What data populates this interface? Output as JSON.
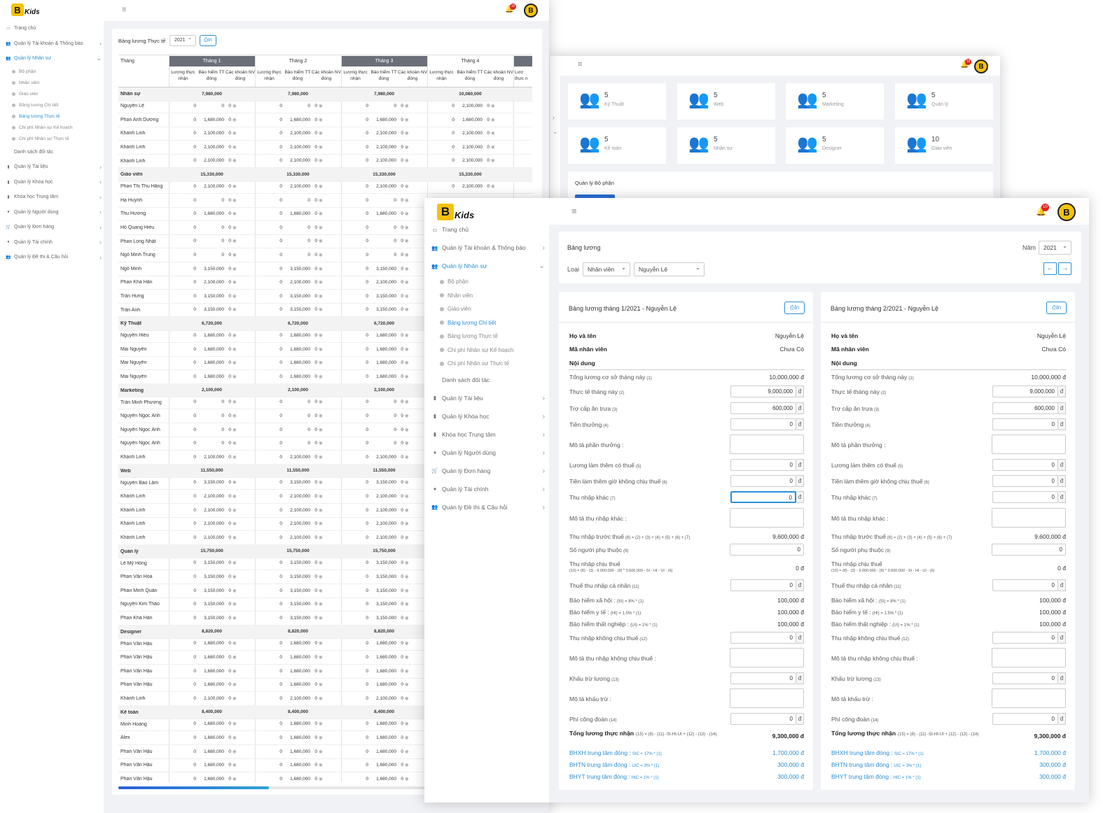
{
  "brand": {
    "logo_letter": "B",
    "logo_text": "Kids",
    "notif_count": "10"
  },
  "sidebar": {
    "items": [
      {
        "label": "Trang chủ",
        "icon": "monitor-icon"
      },
      {
        "label": "Quản lý Tài khoản & Thông báo",
        "icon": "users-icon"
      },
      {
        "label": "Quản lý Nhân sự",
        "icon": "users-icon",
        "active": true
      },
      {
        "label": "Danh sách đối tác",
        "icon": "none"
      },
      {
        "label": "Quản lý Tài liệu",
        "icon": "file-icon"
      },
      {
        "label": "Quản lý Khóa học",
        "icon": "book-icon"
      },
      {
        "label": "Khóa học Trung tâm",
        "icon": "book-icon"
      },
      {
        "label": "Quản lý Người dùng",
        "icon": "user-icon"
      },
      {
        "label": "Quản lý Đơn hàng",
        "icon": "cart-icon"
      },
      {
        "label": "Quản lý Tài chính",
        "icon": "user-icon"
      },
      {
        "label": "Quản lý Đề thi & Câu hỏi",
        "icon": "users-icon"
      }
    ],
    "sub": [
      "Bộ phận",
      "Nhân viên",
      "Giáo viên",
      "Bảng lương Chi tiết",
      "Bảng lương Thực tế",
      "Chi phí Nhân sự Kế hoạch",
      "Chi phí Nhân sự Thực tế"
    ]
  },
  "win1": {
    "title": "Bảng lương Thực tế",
    "year": "2021",
    "print": "In",
    "col_thang": "Tháng",
    "months": [
      "Tháng 1",
      "Tháng 2",
      "Tháng 3",
      "Tháng 4"
    ],
    "sub_cols": [
      "Lương thực nhận",
      "Bảo hiểm TT đóng",
      "Các khoản NV đóng"
    ],
    "sub_cut": "Lươ thực n",
    "rows": [
      {
        "g": 1,
        "n": "Nhân sự",
        "t": [
          "7,980,000",
          "7,980,000",
          "7,980,000",
          "10,080,000"
        ]
      },
      {
        "n": "Nguyễn Lệ",
        "b": [
          "0",
          "0",
          "0",
          "2,100,000"
        ]
      },
      {
        "n": "Phan Anh Dương",
        "b": [
          "1,680,000",
          "1,680,000",
          "1,680,000",
          "1,680,000"
        ]
      },
      {
        "n": "Khánh Linh",
        "b": [
          "2,100,000",
          "2,100,000",
          "2,100,000",
          "2,100,000"
        ]
      },
      {
        "n": "Khánh Linh",
        "b": [
          "2,100,000",
          "2,100,000",
          "2,100,000",
          "2,100,000"
        ]
      },
      {
        "n": "Khánh Linh",
        "b": [
          "2,100,000",
          "2,100,000",
          "2,100,000",
          "2,100,000"
        ]
      },
      {
        "g": 1,
        "n": "Giáo viên",
        "t": [
          "15,330,000",
          "15,330,000",
          "15,330,000",
          "15,330,000"
        ]
      },
      {
        "n": "Phan Thị Thu Hằng",
        "b": [
          "2,100,000",
          "2,100,000",
          "2,100,000",
          "2,100,000"
        ]
      },
      {
        "n": "Hạ Huynh",
        "b": [
          "0",
          "0",
          "0",
          "0"
        ]
      },
      {
        "n": "Thu Hương",
        "b": [
          "1,680,000",
          "1,680,000",
          "1,680,000",
          "1,680,000"
        ]
      },
      {
        "n": "Hồ Quang Hiếu",
        "b": [
          "0",
          "0",
          "0",
          "0"
        ]
      },
      {
        "n": "Phan Long Nhật",
        "b": [
          "0",
          "0",
          "0",
          "0"
        ]
      },
      {
        "n": "Ngô Minh Trung",
        "b": [
          "0",
          "0",
          "0",
          "0"
        ]
      },
      {
        "n": "Ngô Minh",
        "b": [
          "3,150,000",
          "3,150,000",
          "3,150,000",
          "3,150,000"
        ]
      },
      {
        "n": "Phan Khả Hân",
        "b": [
          "2,100,000",
          "2,100,000",
          "2,100,000",
          "2,100,000"
        ]
      },
      {
        "n": "Trần Hưng",
        "b": [
          "3,150,000",
          "3,150,000",
          "3,150,000",
          "3,150,000"
        ]
      },
      {
        "n": "Trần Anh",
        "b": [
          "3,150,000",
          "3,150,000",
          "3,150,000",
          "3,150,000"
        ]
      },
      {
        "g": 1,
        "n": "Kỹ Thuật",
        "t": [
          "6,720,000",
          "6,720,000",
          "6,720,000",
          "6,720,000"
        ]
      },
      {
        "n": "Nguyễn Hiếu",
        "b": [
          "1,680,000",
          "1,680,000",
          "1,680,000",
          "1,680,000"
        ]
      },
      {
        "n": "Mai Nguyễn",
        "b": [
          "1,680,000",
          "1,680,000",
          "1,680,000",
          "1,680,000"
        ]
      },
      {
        "n": "Mai Nguyễn",
        "b": [
          "1,680,000",
          "1,680,000",
          "1,680,000",
          "1,680,000"
        ]
      },
      {
        "n": "Mai Nguyễn",
        "b": [
          "1,680,000",
          "1,680,000",
          "1,680,000",
          "1,680,000"
        ]
      },
      {
        "g": 1,
        "n": "Marketing",
        "t": [
          "2,100,000",
          "2,100,000",
          "2,100,000",
          "2,100,000"
        ]
      },
      {
        "n": "Trần Minh Phương",
        "b": [
          "0",
          "0",
          "0",
          "0"
        ]
      },
      {
        "n": "Nguyễn Ngọc Ánh",
        "b": [
          "0",
          "0",
          "0",
          "0"
        ]
      },
      {
        "n": "Nguyễn Ngọc Ánh",
        "b": [
          "0",
          "0",
          "0",
          "0"
        ]
      },
      {
        "n": "Nguyễn Ngọc Ánh",
        "b": [
          "0",
          "0",
          "0",
          "0"
        ]
      },
      {
        "n": "Khánh Linh",
        "b": [
          "2,100,000",
          "2,100,000",
          "2,100,000",
          "2,100,000"
        ]
      },
      {
        "g": 1,
        "n": "Web",
        "t": [
          "11,550,000",
          "11,550,000",
          "11,550,000",
          "11,550,000"
        ]
      },
      {
        "n": "Nguyễn Bảo Lâm",
        "b": [
          "3,150,000",
          "3,150,000",
          "3,150,000",
          "3,150,000"
        ]
      },
      {
        "n": "Khánh Linh",
        "b": [
          "2,100,000",
          "2,100,000",
          "2,100,000",
          "2,100,000"
        ]
      },
      {
        "n": "Khánh Linh",
        "b": [
          "2,100,000",
          "2,100,000",
          "2,100,000",
          "2,100,000"
        ]
      },
      {
        "n": "Khánh Linh",
        "b": [
          "2,100,000",
          "2,100,000",
          "2,100,000",
          "2,100,000"
        ]
      },
      {
        "n": "Khánh Linh",
        "b": [
          "2,100,000",
          "2,100,000",
          "2,100,000",
          "2,100,000"
        ]
      },
      {
        "g": 1,
        "n": "Quản lý",
        "t": [
          "15,750,000",
          "15,750,000",
          "15,750,000",
          "15,750,000"
        ]
      },
      {
        "n": "Lê Mỹ Hồng",
        "b": [
          "3,150,000",
          "3,150,000",
          "3,150,000",
          "3,150,000"
        ]
      },
      {
        "n": "Phan Văn Hòa",
        "b": [
          "3,150,000",
          "3,150,000",
          "3,150,000",
          "3,150,000"
        ]
      },
      {
        "n": "Phan Minh Quân",
        "b": [
          "3,150,000",
          "3,150,000",
          "3,150,000",
          "3,150,000"
        ]
      },
      {
        "n": "Nguyễn Kim Thảo",
        "b": [
          "3,150,000",
          "3,150,000",
          "3,150,000",
          "3,150,000"
        ]
      },
      {
        "n": "Phan Khả Hân",
        "b": [
          "3,150,000",
          "3,150,000",
          "3,150,000",
          "3,150,000"
        ]
      },
      {
        "g": 1,
        "n": "Designer",
        "t": [
          "8,820,000",
          "8,820,000",
          "8,820,000",
          "8,820,000"
        ]
      },
      {
        "n": "Phan Văn Hậu",
        "b": [
          "1,680,000",
          "1,680,000",
          "1,680,000",
          "1,680,000"
        ]
      },
      {
        "n": "Phan Văn Hậu",
        "b": [
          "1,680,000",
          "1,680,000",
          "1,680,000",
          "1,680,000"
        ]
      },
      {
        "n": "Phan Văn Hậu",
        "b": [
          "1,680,000",
          "1,680,000",
          "1,680,000",
          "1,680,000"
        ]
      },
      {
        "n": "Phan Văn Hậu",
        "b": [
          "1,680,000",
          "1,680,000",
          "1,680,000",
          "1,680,000"
        ]
      },
      {
        "n": "Khánh Linh",
        "b": [
          "2,100,000",
          "2,100,000",
          "2,100,000",
          "2,100,000"
        ]
      },
      {
        "g": 1,
        "n": "Kế toán",
        "t": [
          "8,400,000",
          "8,400,000",
          "8,400,000",
          "8,400,000"
        ]
      },
      {
        "n": "Minh Hoàng",
        "b": [
          "1,680,000",
          "1,680,000",
          "1,680,000",
          "1,680,000"
        ]
      },
      {
        "n": "Alex",
        "b": [
          "1,680,000",
          "1,680,000",
          "1,680,000",
          "1,680,000"
        ]
      },
      {
        "n": "Phan Văn Hậu",
        "b": [
          "1,680,000",
          "1,680,000",
          "1,680,000",
          "1,680,000"
        ]
      },
      {
        "n": "Phan Văn Hậu",
        "b": [
          "1,680,000",
          "1,680,000",
          "1,680,000",
          "1,680,000"
        ]
      },
      {
        "n": "Phan Văn Hậu",
        "b": [
          "1,680,000",
          "1,680,000",
          "1,680,000",
          "1,680,000"
        ]
      }
    ]
  },
  "win2": {
    "stats": [
      {
        "n": "5",
        "t": "Kỹ Thuật",
        "c": "#777777"
      },
      {
        "n": "5",
        "t": "Web",
        "c": "#21a366"
      },
      {
        "n": "5",
        "t": "Marketing",
        "c": "#9b7ad6"
      },
      {
        "n": "5",
        "t": "Quản lý",
        "c": "#2a8fd6"
      },
      {
        "n": "5",
        "t": "Kế toán",
        "c": "#f0845f"
      },
      {
        "n": "5",
        "t": "Nhân sự",
        "c": "#3bb34a"
      },
      {
        "n": "5",
        "t": "Designer",
        "c": "#2f3f8f"
      },
      {
        "n": "10",
        "t": "Giáo viên",
        "c": "#666666"
      }
    ],
    "section_title": "Quản lý Bộ phận"
  },
  "win3": {
    "title": "Bảng lương",
    "year_label": "Năm",
    "year": "2021",
    "type_label": "Loại",
    "type_value": "Nhân viên",
    "person": "Nguyễn Lệ",
    "labels": {
      "ho_ten": "Họ và tên",
      "ma_nv": "Mã nhân viên",
      "noi_dung": "Nội dung",
      "l1": "Tổng lương cơ sở tháng này",
      "l1n": "(1)",
      "l2": "Thực tế tháng này",
      "l2n": "(2)",
      "l3": "Trợ cấp ăn trưa",
      "l3n": "(3)",
      "l4": "Tiền thưởng",
      "l4n": "(4)",
      "mt_thuong": "Mô tả phần thưởng :",
      "l5": "Lương làm thêm có thuế",
      "l5n": "(5)",
      "l6": "Tiền làm thêm giờ không chịu thuế",
      "l6n": "(6)",
      "l7": "Thu nhập khác",
      "l7n": "(7)",
      "mt_khac": "Mô tả thu nhập khác :",
      "l8": "Thu nhập trước thuế",
      "l8n": "(8) = (2) + (3) + (4) + (5) + (6) + (7)",
      "l9": "Số người phụ thuộc",
      "l9n": "(9)",
      "l10": "Thu nhập chịu thuế",
      "l10n": "(10) = (8) - (3) - 9.000.000 - (9) * 3.600.000 - SI - HI - UI - (6)",
      "l11": "Thuế thu nhập cá nhân",
      "l11n": "(11)",
      "si": "Bảo hiểm xã hội :",
      "sin": "(SI) = 8% * (1)",
      "hi": "Bảo hiểm y tế :",
      "hin": "(HI) = 1.5% * (1)",
      "ui": "Bảo hiểm thất nghiệp :",
      "uin": "(UI) = 1% * (1)",
      "l12": "Thu nhập không chịu thuế",
      "l12n": "(12)",
      "mt_kct": "Mô tả thu nhập không chịu thuế :",
      "l13": "Khấu trừ lương",
      "l13n": "(13)",
      "mt_kt": "Mô tả khấu trừ :",
      "l14": "Phí công đoàn",
      "l14n": "(14)",
      "l15": "Tổng lương thực nhận",
      "l15n": "(15) = (8) - (11) -SI-HI-UI + (12) - (13) - (14)",
      "bhxh": "BHXH trung tâm đóng :",
      "bhxhn": "SIC = 17% * (1)",
      "bhtn": "BHTN trung tâm đóng :",
      "bhtnn": "UIC = 3% * (1)",
      "bhyt": "BHYT trung tâm đóng :",
      "bhytn": "HIC = 1% * (1)"
    },
    "unit": "đ",
    "cards": [
      {
        "title": "Bảng lương tháng 1/2021 - Nguyễn Lệ",
        "name": "Nguyễn Lệ",
        "code": "Chưa Có",
        "v1": "10,000,000 đ",
        "v2": "9,000,000",
        "v3": "600,000",
        "v4": "0",
        "v5": "0",
        "v6": "0",
        "v7": "0",
        "v8": "9,600,000 đ",
        "v9": "0",
        "v10": "0 đ",
        "v11": "0",
        "si": "100,000 đ",
        "hi": "100,000 đ",
        "ui": "100,000 đ",
        "v12": "0",
        "v13": "0",
        "v14": "0",
        "v15": "9,300,000 đ",
        "bhxh": "1,700,000 đ",
        "bhtn": "300,000 đ",
        "bhyt": "300,000 đ"
      },
      {
        "title": "Bảng lương tháng 2/2021 - Nguyễn Lệ",
        "name": "Nguyễn Lệ",
        "code": "Chưa Có",
        "v1": "10,000,000 đ",
        "v2": "9,000,000",
        "v3": "600,000",
        "v4": "0",
        "v5": "0",
        "v6": "0",
        "v7": "0",
        "v8": "9,600,000 đ",
        "v9": "0",
        "v10": "0 đ",
        "v11": "0",
        "si": "100,000 đ",
        "hi": "100,000 đ",
        "ui": "100,000 đ",
        "v12": "0",
        "v13": "0",
        "v14": "0",
        "v15": "9,300,000 đ",
        "bhxh": "1,700,000 đ",
        "bhtn": "300,000 đ",
        "bhyt": "300,000 đ"
      }
    ],
    "print": "In"
  }
}
